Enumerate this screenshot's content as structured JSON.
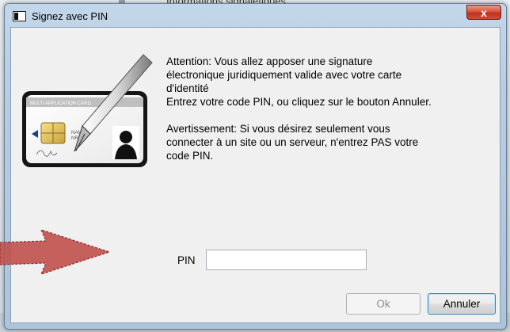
{
  "background": {
    "partial_text": "Informations signalétiques"
  },
  "window": {
    "title": "Signez avec PIN",
    "close_label": "x"
  },
  "illustration": {
    "card_header": "MULTI APPLICATION CARD",
    "card_lines": [
      "NAME",
      "NR"
    ]
  },
  "message": "Attention: Vous allez apposer une signature\nélectronique juridiquement valide avec votre carte\nd'identité\nEntrez votre code PIN, ou cliquez sur le bouton Annuler.\n\nAvertissement: Si vous désirez seulement vous\nconnecter à un site ou un serveur, n'entrez PAS votre\ncode PIN.",
  "pin": {
    "label": "PIN",
    "value": ""
  },
  "buttons": {
    "ok": "Ok",
    "cancel": "Annuler"
  },
  "colors": {
    "arrow": "#c0504d",
    "title_bar": "#b7cce1",
    "close_button": "#c1331c"
  }
}
